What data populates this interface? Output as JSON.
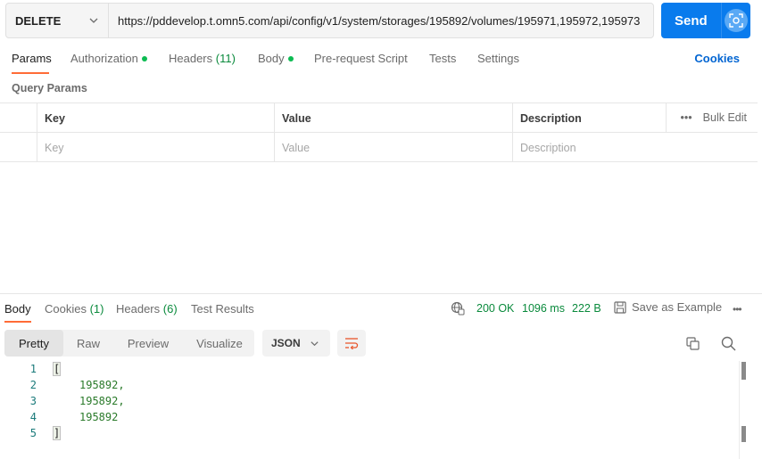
{
  "request": {
    "method": "DELETE",
    "url": "https://pddevelop.t.omn5.com/api/config/v1/system/storages/195892/volumes/195971,195972,195973",
    "send_label": "Send"
  },
  "request_tabs": [
    {
      "label": "Params",
      "active": true
    },
    {
      "label": "Authorization",
      "dot": true
    },
    {
      "label": "Headers",
      "count": "(11)"
    },
    {
      "label": "Body",
      "dot": true
    },
    {
      "label": "Pre-request Script"
    },
    {
      "label": "Tests"
    },
    {
      "label": "Settings"
    }
  ],
  "cookies_link": "Cookies",
  "query_params": {
    "title": "Query Params",
    "columns": [
      "Key",
      "Value",
      "Description"
    ],
    "placeholders": [
      "Key",
      "Value",
      "Description"
    ],
    "bulk_edit": "Bulk Edit"
  },
  "response": {
    "tabs": [
      {
        "label": "Body",
        "active": true
      },
      {
        "label": "Cookies",
        "count": "(1)"
      },
      {
        "label": "Headers",
        "count": "(6)"
      },
      {
        "label": "Test Results"
      }
    ],
    "status": "200 OK",
    "time": "1096 ms",
    "size": "222 B",
    "save_example": "Save as Example",
    "formats": [
      "Pretty",
      "Raw",
      "Preview",
      "Visualize"
    ],
    "active_format": "Pretty",
    "language": "JSON",
    "lines": [
      {
        "n": "1",
        "text": "["
      },
      {
        "n": "2",
        "text": "195892,"
      },
      {
        "n": "3",
        "text": "195892,"
      },
      {
        "n": "4",
        "text": "195892"
      },
      {
        "n": "5",
        "text": "]"
      }
    ]
  },
  "colors": {
    "accent": "#ff6c37",
    "send": "#097bed",
    "link": "#0265d2",
    "success": "#0a8a3c"
  }
}
